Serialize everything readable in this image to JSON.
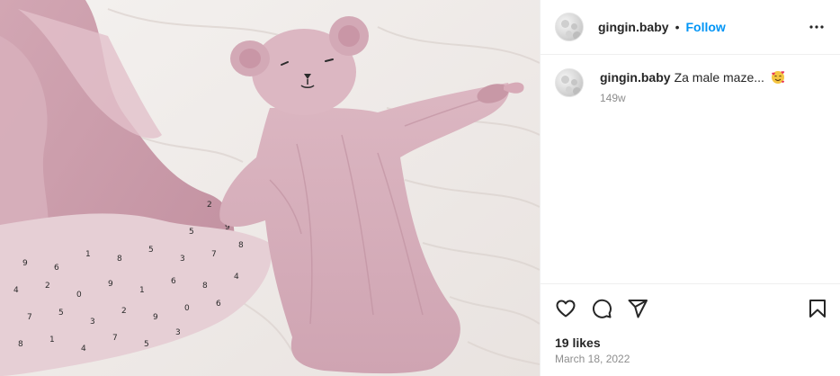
{
  "post": {
    "author": {
      "username": "gingin.baby",
      "avatar_icon": "profile-avatar"
    },
    "header": {
      "separator": "•",
      "follow_label": "Follow",
      "more_icon": "more-horizontal-icon"
    },
    "caption": {
      "username": "gingin.baby",
      "text": "Za male maze...",
      "emoji_icon": "smiling-face-with-hearts-emoji",
      "time_ago": "149w"
    },
    "actions": {
      "like_icon": "heart-icon",
      "comment_icon": "comment-icon",
      "share_icon": "share-icon",
      "save_icon": "bookmark-icon"
    },
    "likes": "19 likes",
    "date": "March 18, 2022",
    "media": {
      "description_icon": "photo-pink-muslin-bunny-comforter",
      "colors": {
        "sheet": "#f1ecea",
        "muslin": "#d9b4bf",
        "muslin_shadow": "#c79aa8",
        "print": "#2b2b2b"
      }
    },
    "colors": {
      "accent": "#0095f6",
      "text": "#262626",
      "muted": "#8e8e8e",
      "divider": "#efefef"
    }
  }
}
